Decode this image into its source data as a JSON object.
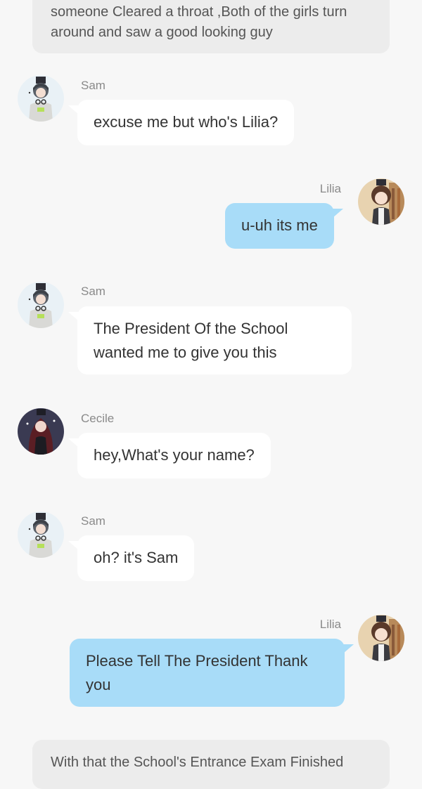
{
  "narration": {
    "top": "someone Cleared a throat ,Both of the girls turn around and saw a good looking guy",
    "bottom": "With that the School's Entrance Exam Finished"
  },
  "messages": [
    {
      "sender": "Sam",
      "text": "excuse me but who's Lilia?",
      "side": "left"
    },
    {
      "sender": "Lilia",
      "text": "u-uh its me",
      "side": "right"
    },
    {
      "sender": "Sam",
      "text": "The President Of the School wanted me to give you this",
      "side": "left"
    },
    {
      "sender": "Cecile",
      "text": "hey,What's your name?",
      "side": "left"
    },
    {
      "sender": "Sam",
      "text": "oh? it's Sam",
      "side": "left"
    },
    {
      "sender": "Lilia",
      "text": "Please Tell The President Thank you",
      "side": "right"
    }
  ],
  "avatars": {
    "sam": "sam-avatar",
    "lilia": "lilia-avatar",
    "cecile": "cecile-avatar"
  },
  "colors": {
    "background": "#f7f7f7",
    "narration_bg": "#ececec",
    "incoming_bubble": "#ffffff",
    "outgoing_bubble": "#a8dcf8",
    "name_text": "#8a8a8a"
  }
}
